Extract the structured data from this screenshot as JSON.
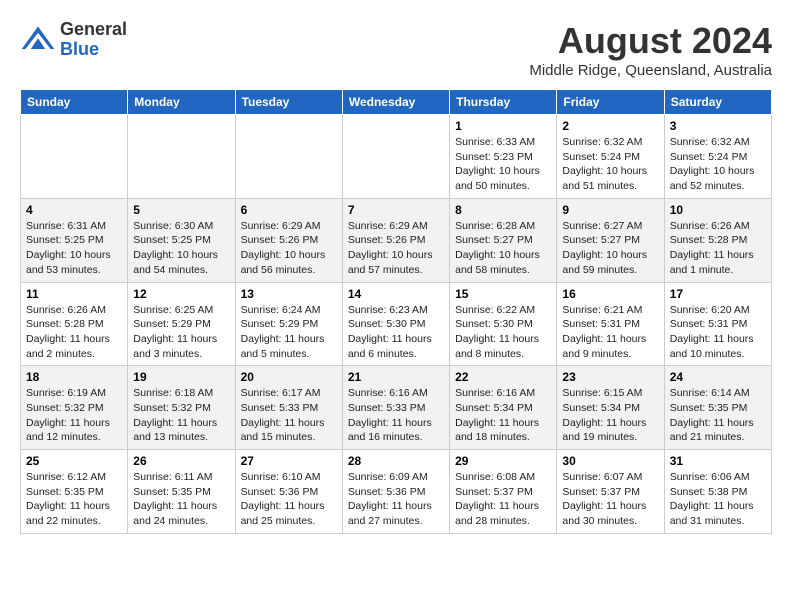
{
  "header": {
    "logo_general": "General",
    "logo_blue": "Blue",
    "month": "August 2024",
    "location": "Middle Ridge, Queensland, Australia"
  },
  "weekdays": [
    "Sunday",
    "Monday",
    "Tuesday",
    "Wednesday",
    "Thursday",
    "Friday",
    "Saturday"
  ],
  "weeks": [
    [
      {
        "day": "",
        "info": ""
      },
      {
        "day": "",
        "info": ""
      },
      {
        "day": "",
        "info": ""
      },
      {
        "day": "",
        "info": ""
      },
      {
        "day": "1",
        "info": "Sunrise: 6:33 AM\nSunset: 5:23 PM\nDaylight: 10 hours\nand 50 minutes."
      },
      {
        "day": "2",
        "info": "Sunrise: 6:32 AM\nSunset: 5:24 PM\nDaylight: 10 hours\nand 51 minutes."
      },
      {
        "day": "3",
        "info": "Sunrise: 6:32 AM\nSunset: 5:24 PM\nDaylight: 10 hours\nand 52 minutes."
      }
    ],
    [
      {
        "day": "4",
        "info": "Sunrise: 6:31 AM\nSunset: 5:25 PM\nDaylight: 10 hours\nand 53 minutes."
      },
      {
        "day": "5",
        "info": "Sunrise: 6:30 AM\nSunset: 5:25 PM\nDaylight: 10 hours\nand 54 minutes."
      },
      {
        "day": "6",
        "info": "Sunrise: 6:29 AM\nSunset: 5:26 PM\nDaylight: 10 hours\nand 56 minutes."
      },
      {
        "day": "7",
        "info": "Sunrise: 6:29 AM\nSunset: 5:26 PM\nDaylight: 10 hours\nand 57 minutes."
      },
      {
        "day": "8",
        "info": "Sunrise: 6:28 AM\nSunset: 5:27 PM\nDaylight: 10 hours\nand 58 minutes."
      },
      {
        "day": "9",
        "info": "Sunrise: 6:27 AM\nSunset: 5:27 PM\nDaylight: 10 hours\nand 59 minutes."
      },
      {
        "day": "10",
        "info": "Sunrise: 6:26 AM\nSunset: 5:28 PM\nDaylight: 11 hours\nand 1 minute."
      }
    ],
    [
      {
        "day": "11",
        "info": "Sunrise: 6:26 AM\nSunset: 5:28 PM\nDaylight: 11 hours\nand 2 minutes."
      },
      {
        "day": "12",
        "info": "Sunrise: 6:25 AM\nSunset: 5:29 PM\nDaylight: 11 hours\nand 3 minutes."
      },
      {
        "day": "13",
        "info": "Sunrise: 6:24 AM\nSunset: 5:29 PM\nDaylight: 11 hours\nand 5 minutes."
      },
      {
        "day": "14",
        "info": "Sunrise: 6:23 AM\nSunset: 5:30 PM\nDaylight: 11 hours\nand 6 minutes."
      },
      {
        "day": "15",
        "info": "Sunrise: 6:22 AM\nSunset: 5:30 PM\nDaylight: 11 hours\nand 8 minutes."
      },
      {
        "day": "16",
        "info": "Sunrise: 6:21 AM\nSunset: 5:31 PM\nDaylight: 11 hours\nand 9 minutes."
      },
      {
        "day": "17",
        "info": "Sunrise: 6:20 AM\nSunset: 5:31 PM\nDaylight: 11 hours\nand 10 minutes."
      }
    ],
    [
      {
        "day": "18",
        "info": "Sunrise: 6:19 AM\nSunset: 5:32 PM\nDaylight: 11 hours\nand 12 minutes."
      },
      {
        "day": "19",
        "info": "Sunrise: 6:18 AM\nSunset: 5:32 PM\nDaylight: 11 hours\nand 13 minutes."
      },
      {
        "day": "20",
        "info": "Sunrise: 6:17 AM\nSunset: 5:33 PM\nDaylight: 11 hours\nand 15 minutes."
      },
      {
        "day": "21",
        "info": "Sunrise: 6:16 AM\nSunset: 5:33 PM\nDaylight: 11 hours\nand 16 minutes."
      },
      {
        "day": "22",
        "info": "Sunrise: 6:16 AM\nSunset: 5:34 PM\nDaylight: 11 hours\nand 18 minutes."
      },
      {
        "day": "23",
        "info": "Sunrise: 6:15 AM\nSunset: 5:34 PM\nDaylight: 11 hours\nand 19 minutes."
      },
      {
        "day": "24",
        "info": "Sunrise: 6:14 AM\nSunset: 5:35 PM\nDaylight: 11 hours\nand 21 minutes."
      }
    ],
    [
      {
        "day": "25",
        "info": "Sunrise: 6:12 AM\nSunset: 5:35 PM\nDaylight: 11 hours\nand 22 minutes."
      },
      {
        "day": "26",
        "info": "Sunrise: 6:11 AM\nSunset: 5:35 PM\nDaylight: 11 hours\nand 24 minutes."
      },
      {
        "day": "27",
        "info": "Sunrise: 6:10 AM\nSunset: 5:36 PM\nDaylight: 11 hours\nand 25 minutes."
      },
      {
        "day": "28",
        "info": "Sunrise: 6:09 AM\nSunset: 5:36 PM\nDaylight: 11 hours\nand 27 minutes."
      },
      {
        "day": "29",
        "info": "Sunrise: 6:08 AM\nSunset: 5:37 PM\nDaylight: 11 hours\nand 28 minutes."
      },
      {
        "day": "30",
        "info": "Sunrise: 6:07 AM\nSunset: 5:37 PM\nDaylight: 11 hours\nand 30 minutes."
      },
      {
        "day": "31",
        "info": "Sunrise: 6:06 AM\nSunset: 5:38 PM\nDaylight: 11 hours\nand 31 minutes."
      }
    ]
  ]
}
